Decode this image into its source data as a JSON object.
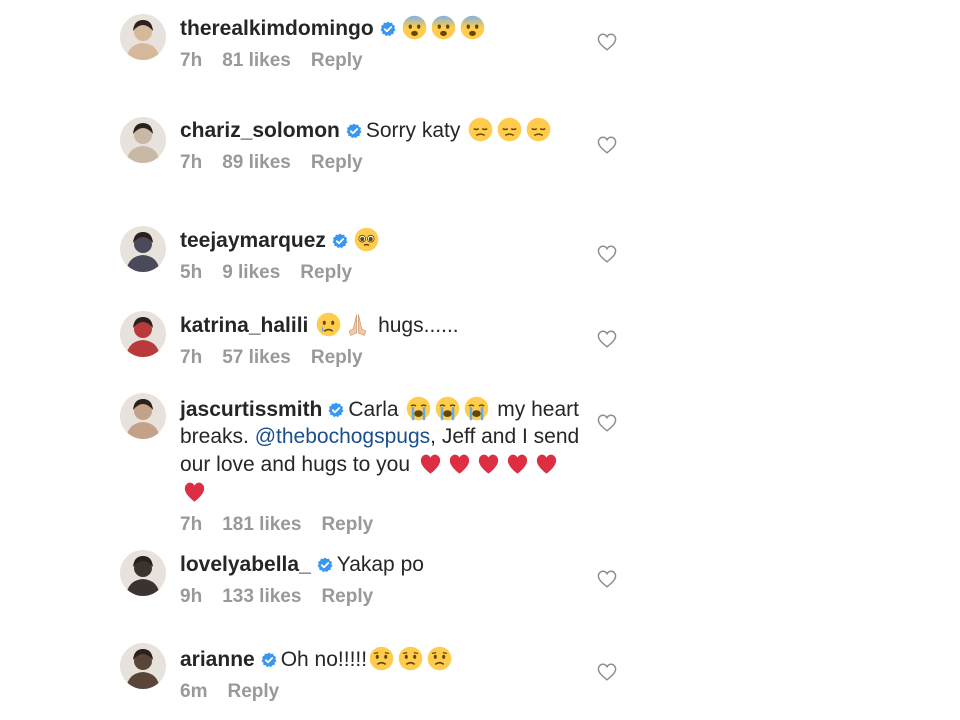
{
  "comments": [
    {
      "username": "therealkimdomingo",
      "verified": true,
      "parts": [
        {
          "type": "emoji",
          "icon": "fearful-face-emoji"
        },
        {
          "type": "emoji",
          "icon": "fearful-face-emoji"
        },
        {
          "type": "emoji",
          "icon": "fearful-face-emoji"
        }
      ],
      "time": "7h",
      "likes": "81 likes",
      "reply": "Reply",
      "avatar_color": "#d6b99a"
    },
    {
      "username": "chariz_solomon",
      "verified": true,
      "parts": [
        {
          "type": "text",
          "value": "Sorry katy "
        },
        {
          "type": "emoji",
          "icon": "pensive-face-emoji"
        },
        {
          "type": "emoji",
          "icon": "pensive-face-emoji"
        },
        {
          "type": "emoji",
          "icon": "pensive-face-emoji"
        }
      ],
      "time": "7h",
      "likes": "89 likes",
      "reply": "Reply",
      "avatar_color": "#c9b8a6"
    },
    {
      "username": "teejaymarquez",
      "verified": true,
      "parts": [
        {
          "type": "emoji",
          "icon": "pleading-face-emoji"
        }
      ],
      "time": "5h",
      "likes": "9 likes",
      "reply": "Reply",
      "avatar_color": "#4a4a5a"
    },
    {
      "username": "katrina_halili",
      "verified": false,
      "parts": [
        {
          "type": "emoji",
          "icon": "crying-face-emoji"
        },
        {
          "type": "emoji",
          "icon": "folded-hands-emoji"
        },
        {
          "type": "text",
          "value": " hugs......"
        }
      ],
      "time": "7h",
      "likes": "57 likes",
      "reply": "Reply",
      "avatar_color": "#b83a3a"
    },
    {
      "username": "jascurtissmith",
      "verified": true,
      "parts": [
        {
          "type": "text",
          "value": "Carla "
        },
        {
          "type": "emoji",
          "icon": "loudly-crying-face-emoji"
        },
        {
          "type": "emoji",
          "icon": "loudly-crying-face-emoji"
        },
        {
          "type": "emoji",
          "icon": "loudly-crying-face-emoji"
        },
        {
          "type": "text",
          "value": " my heart breaks. "
        },
        {
          "type": "mention",
          "value": "@thebochogspugs"
        },
        {
          "type": "text",
          "value": ", Jeff and I send our love and hugs  to you "
        },
        {
          "type": "emoji",
          "icon": "red-heart-emoji"
        },
        {
          "type": "emoji",
          "icon": "red-heart-emoji"
        },
        {
          "type": "emoji",
          "icon": "red-heart-emoji"
        },
        {
          "type": "emoji",
          "icon": "red-heart-emoji"
        },
        {
          "type": "emoji",
          "icon": "red-heart-emoji"
        },
        {
          "type": "emoji",
          "icon": "red-heart-emoji"
        }
      ],
      "time": "7h",
      "likes": "181 likes",
      "reply": "Reply",
      "avatar_color": "#c4a189"
    },
    {
      "username": "lovelyabella_",
      "verified": true,
      "parts": [
        {
          "type": "text",
          "value": "Yakap po"
        }
      ],
      "time": "9h",
      "likes": "133 likes",
      "reply": "Reply",
      "avatar_color": "#3b3330"
    },
    {
      "username": "arianne",
      "verified": true,
      "parts": [
        {
          "type": "text",
          "value": "Oh no!!!!!"
        },
        {
          "type": "emoji",
          "icon": "sad-face-emoji"
        },
        {
          "type": "emoji",
          "icon": "sad-face-emoji"
        },
        {
          "type": "emoji",
          "icon": "sad-face-emoji"
        }
      ],
      "time": "6m",
      "likes": "",
      "reply": "Reply",
      "avatar_color": "#5a4638"
    }
  ],
  "colors": {
    "text": "#262626",
    "meta": "#999999",
    "verified": "#3897f0",
    "mention": "#1b4f8c",
    "heart_outline": "#8e8e8e"
  }
}
